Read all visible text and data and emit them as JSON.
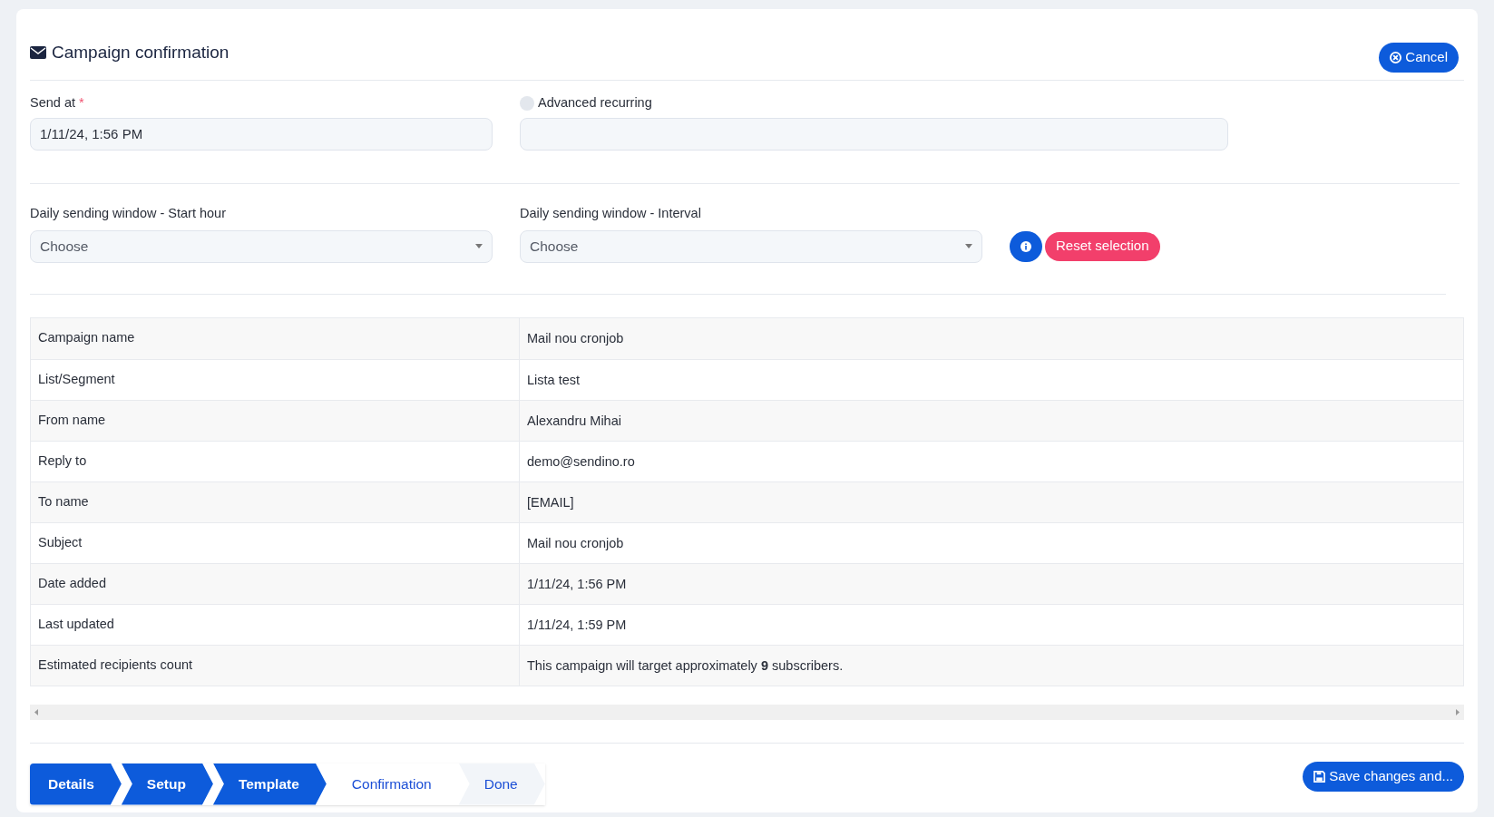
{
  "header": {
    "title": "Campaign confirmation",
    "cancel_button": "Cancel"
  },
  "send_at": {
    "label": "Send at",
    "required_mark": "*",
    "value": "1/11/24, 1:56 PM"
  },
  "advanced_recurring": {
    "label": "Advanced recurring",
    "checked": false
  },
  "start_hour": {
    "label": "Daily sending window - Start hour",
    "placeholder": "Choose"
  },
  "interval": {
    "label": "Daily sending window - Interval",
    "placeholder": "Choose"
  },
  "reset_button": "Reset selection",
  "summary": [
    {
      "label": "Campaign name",
      "value": "Mail nou cronjob"
    },
    {
      "label": "List/Segment",
      "value": "Lista test"
    },
    {
      "label": "From name",
      "value": "Alexandru Mihai"
    },
    {
      "label": "Reply to",
      "value": "demo@sendino.ro"
    },
    {
      "label": "To name",
      "value": "[EMAIL]"
    },
    {
      "label": "Subject",
      "value": "Mail nou cronjob"
    },
    {
      "label": "Date added",
      "value": "1/11/24, 1:56 PM"
    },
    {
      "label": "Last updated",
      "value": "1/11/24, 1:59 PM"
    },
    {
      "label": "Estimated recipients count",
      "value": "This campaign will target approximately **9** subscribers."
    }
  ],
  "steps": [
    {
      "label": "Details",
      "completed": true,
      "selected": false
    },
    {
      "label": "Setup",
      "completed": true,
      "selected": false
    },
    {
      "label": "Template",
      "completed": true,
      "selected": false
    },
    {
      "label": "Confirmation",
      "completed": false,
      "selected": true
    },
    {
      "label": "Done",
      "completed": false,
      "selected": false
    }
  ],
  "save_button": "Save changes and..."
}
